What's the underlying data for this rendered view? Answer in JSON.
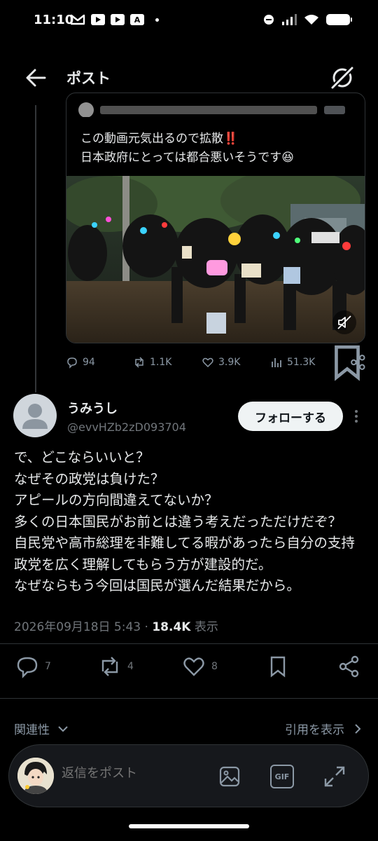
{
  "status_bar": {
    "time": "11:10",
    "left_icons": [
      "gmail-icon",
      "youtube-icon",
      "youtube-icon",
      "font-app-icon"
    ],
    "right_icons": [
      "dnd-icon",
      "signal-icon",
      "wifi-icon",
      "battery-icon"
    ]
  },
  "header": {
    "title": "ポスト",
    "back_icon": "arrow-left-icon",
    "grok_icon": "grok-icon"
  },
  "quoted_post": {
    "text": "この動画元気出るので拡散‼️\n日本政府にとっては都合悪いそうです😆",
    "media": "protest-crowd-video",
    "stats": {
      "replies": "94",
      "reposts": "1.1K",
      "likes": "3.9K",
      "views": "51.3K"
    }
  },
  "post": {
    "author_name": "うみうし",
    "author_handle": "@evvHZb2zD093704",
    "follow_label": "フォローする",
    "body": "で、どこならいいと？\nなぜその政党は負けた？\nアピールの方向間違えてないか？\n多くの日本国民がお前とは違う考えだっただけだぞ？\n自民党や高市総理を非難してる暇があったら自分の支持政党を広く理解してもらう方が建設的だ。\nなぜならもう今回は国民が選んだ結果だから。",
    "timestamp": "2026年09月18日 5:43",
    "separator": " · ",
    "views": "18.4K",
    "views_label": "表示",
    "actions": {
      "replies": "7",
      "reposts": "4",
      "likes": "8"
    }
  },
  "relevance": {
    "sort_label": "関連性",
    "quotes_label": "引用を表示"
  },
  "reply_bar": {
    "placeholder": "返信をポスト",
    "gif_label": "GIF"
  },
  "colors": {
    "background": "#000000",
    "text_primary": "#e7e9ea",
    "text_secondary": "#71767b",
    "border": "#2f3336",
    "follow_bg": "#eff3f4"
  }
}
